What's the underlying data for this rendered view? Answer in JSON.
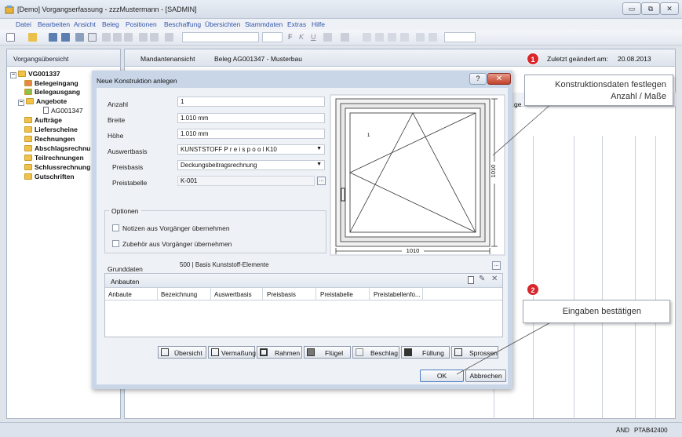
{
  "window": {
    "title": "[Demo] Vorgangserfassung - zzzMustermann - [SADMIN]",
    "minimize_glyph": "▭",
    "maximize_glyph": "⧉",
    "close_glyph": "✕"
  },
  "menu": [
    "Datei",
    "Bearbeiten",
    "Ansicht",
    "Beleg",
    "Positionen",
    "Beschaffung",
    "Übersichten",
    "Stammdaten",
    "Extras",
    "Hilfe"
  ],
  "toolbar": {
    "bold": "F",
    "italic": "K",
    "underline": "U"
  },
  "left_panel": {
    "title": "Vorgangsübersicht",
    "tree": [
      {
        "label": "VG001337",
        "bold": true,
        "expander": "−"
      },
      {
        "label": "Belegeingang",
        "bold": true
      },
      {
        "label": "Belegausgang",
        "bold": true
      },
      {
        "label": "Angebote",
        "bold": true,
        "expander": "−"
      },
      {
        "label": "AG001347",
        "bold": false
      },
      {
        "label": "Aufträge",
        "bold": true
      },
      {
        "label": "Lieferscheine",
        "bold": true
      },
      {
        "label": "Rechnungen",
        "bold": true
      },
      {
        "label": "Abschlagsrechnu",
        "bold": true
      },
      {
        "label": "Teilrechnungen",
        "bold": true
      },
      {
        "label": "Schlussrechnung",
        "bold": true
      },
      {
        "label": "Gutschriften",
        "bold": true
      }
    ]
  },
  "right_panel": {
    "mandant_label": "Mandantenansicht",
    "beleg": "Beleg AG001347 - Musterbau",
    "changed_label": "Zuletzt geändert am:",
    "changed_date": "20.08.2013",
    "partial_header": "ge"
  },
  "dialog": {
    "title": "Neue Konstruktion anlegen",
    "help_glyph": "?",
    "close_glyph": "✕",
    "fields": {
      "anzahl": {
        "label": "Anzahl",
        "value": "1"
      },
      "breite": {
        "label": "Breite",
        "value": "1.010 mm"
      },
      "hoehe": {
        "label": "Höhe",
        "value": "1.010 mm"
      },
      "auswertbasis": {
        "label": "Auswertbasis",
        "value": "KUNSTSTOFF  P r e i s p o o l K10"
      },
      "preisbasis": {
        "label": "Preisbasis",
        "value": "Deckungsbeitragsrechnung"
      },
      "preistabelle": {
        "label": "Preistabelle",
        "value": "K-001"
      }
    },
    "dots": "...",
    "options": {
      "legend": "Optionen",
      "notizen": "Notizen aus Vorgänger übernehmen",
      "zubehoer": "Zubehör aus Vorgänger übernehmen"
    },
    "preview": {
      "width_label": "1010",
      "height_label": "1010",
      "sash_number": "1"
    },
    "grunddaten": {
      "label": "Grunddaten",
      "value": "500 | Basis Kunststoff-Elemente"
    },
    "anbauten": {
      "title": "Anbauten",
      "columns": [
        "Anbaute",
        "Bezeichnung",
        "Auswertbasis",
        "Preisbasis",
        "Preistabelle",
        "Preistabellenfo..."
      ]
    },
    "tabs": [
      "Übersicht",
      "Vermaßung",
      "Rahmen",
      "Flügel",
      "Beschlag",
      "Füllung",
      "Sprossen"
    ],
    "ok": "OK",
    "cancel": "Abbrechen"
  },
  "callouts": {
    "one": {
      "number": "1",
      "text_line1": "Konstruktionsdaten festlegen",
      "text_line2": "Anzahl / Maße"
    },
    "two": {
      "number": "2",
      "text": "Eingaben bestätigen"
    }
  },
  "status": {
    "left": "ÄND",
    "code": "PTAB42400"
  }
}
